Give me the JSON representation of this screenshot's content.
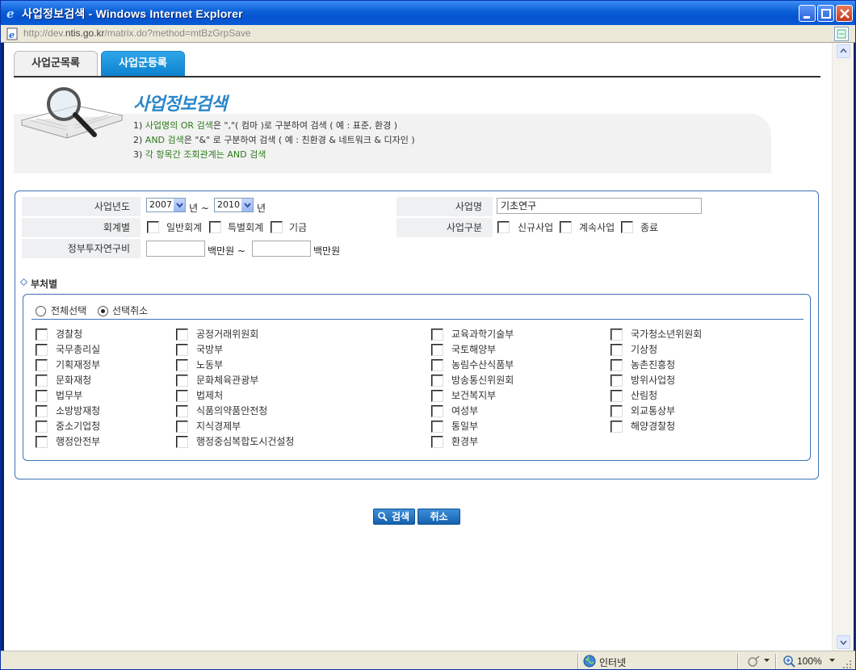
{
  "window": {
    "title": "사업정보검색 - Windows Internet Explorer",
    "url_prefix": "http://dev.",
    "url_domain": "ntis.go.kr",
    "url_path": "/matrix.do?method=mtBzGrpSave"
  },
  "tabs": [
    {
      "label": "사업군목록",
      "active": false
    },
    {
      "label": "사업군등록",
      "active": true
    }
  ],
  "intro": {
    "title": "사업정보검색",
    "rule1_num": "1)",
    "rule1_green": "사업명의 OR 검색",
    "rule1_rest": "은 \",\"( 컴마 )로 구분하여 검색 ( 예 : 표준, 환경 )",
    "rule2_num": "2)",
    "rule2_green": "AND 검색",
    "rule2_rest": "은 \"&\" 로 구분하여 검색 ( 예 : 친환경 & 네트워크 & 디자인 )",
    "rule3_num": "3)",
    "rule3_green": "각 항목간 조회관계는 AND 검색"
  },
  "form": {
    "year_label": "사업년도",
    "year_from": "2007",
    "year_unit1": "년 ~",
    "year_to": "2010",
    "year_unit2": "년",
    "name_label": "사업명",
    "name_value": "기초연구",
    "account_label": "회계별",
    "account_options": [
      {
        "label": "일반회계",
        "checked": false
      },
      {
        "label": "특별회계",
        "checked": false
      },
      {
        "label": "기금",
        "checked": false
      }
    ],
    "type_label": "사업구분",
    "type_options": [
      {
        "label": "신규사업",
        "checked": false
      },
      {
        "label": "계속사업",
        "checked": false
      },
      {
        "label": "종료",
        "checked": false
      }
    ],
    "budget_label": "정부투자연구비",
    "budget_unit1": "백만원 ~",
    "budget_unit2": "백만원",
    "budget_from": "",
    "budget_to": ""
  },
  "ministry": {
    "section_title": "부처별",
    "select_all": "전체선택",
    "deselect_all": "선택취소",
    "selected_mode": "deselect_all",
    "columns": [
      [
        "경찰청",
        "국무총리실",
        "기획재정부",
        "문화재청",
        "법무부",
        "소방방재청",
        "중소기업청",
        "행정안전부"
      ],
      [
        "공정거래위원회",
        "국방부",
        "노동부",
        "문화체육관광부",
        "법제처",
        "식품의약품안전청",
        "지식경제부",
        "행정중심복합도시건설청"
      ],
      [
        "교육과학기술부",
        "국토해양부",
        "농림수산식품부",
        "방송통신위원회",
        "보건복지부",
        "여성부",
        "통일부",
        "환경부"
      ],
      [
        "국가청소년위원회",
        "기상청",
        "농촌진흥청",
        "방위사업청",
        "산림청",
        "외교통상부",
        "해양경찰청"
      ]
    ]
  },
  "buttons": {
    "search": "검색",
    "cancel": "취소"
  },
  "status": {
    "zone": "인터넷",
    "zoom": "100%"
  },
  "colors": {
    "accent": "#2b86c9",
    "rule_green": "#2d7a1c",
    "border_blue": "#3d73b8",
    "titlebar": "#0553cf"
  }
}
